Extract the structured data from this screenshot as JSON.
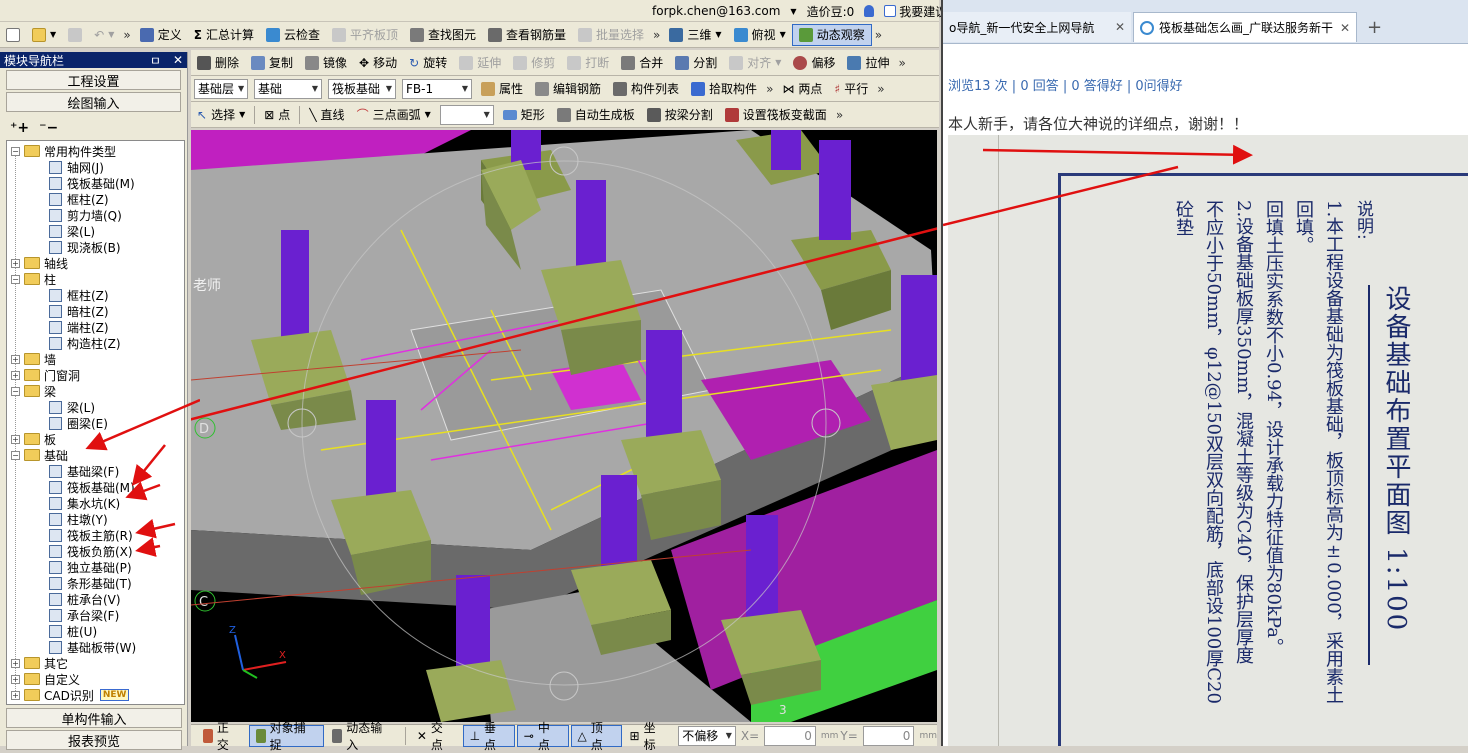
{
  "account": {
    "email": "forpk.chen@163.com",
    "credit": "造价豆:0",
    "suggest": "我要建议"
  },
  "toolbar1": {
    "define": "定义",
    "sum_calc": "汇总计算",
    "cloud_check": "云检查",
    "level_slab": "平齐板顶",
    "find_element": "查找图元",
    "view_rebar": "查看钢筋量",
    "batch_select": "批量选择",
    "view3d": "三维",
    "top_view": "俯视",
    "dynamic_view": "动态观察"
  },
  "toolbar2": {
    "delete": "删除",
    "copy": "复制",
    "mirror": "镜像",
    "move": "移动",
    "rotate": "旋转",
    "extend": "延伸",
    "trim": "修剪",
    "break": "打断",
    "merge": "合并",
    "split": "分割",
    "align": "对齐",
    "offset": "偏移",
    "stretch": "拉伸"
  },
  "toolbar3": {
    "layer": "基础层",
    "category": "基础",
    "type": "筏板基础",
    "element": "FB-1",
    "properties": "属性",
    "edit_rebar": "编辑钢筋",
    "component_list": "构件列表",
    "pick": "拾取构件",
    "two_points": "两点",
    "parallel": "平行"
  },
  "toolbar4": {
    "select": "选择",
    "point": "点",
    "line": "直线",
    "arc3": "三点画弧",
    "rect": "矩形",
    "auto_gen": "自动生成板",
    "by_beam": "按梁分割",
    "section": "设置筏板变截面"
  },
  "nav": {
    "title": "模块导航栏",
    "pin": "ㅁ",
    "close": "✕",
    "project_settings": "工程设置",
    "draw_input": "绘图输入",
    "single_input": "单构件输入",
    "report": "报表预览",
    "tree": [
      {
        "label": "常用构件类型",
        "level": 0,
        "exp": "−",
        "folder": true
      },
      {
        "label": "轴网(J)",
        "level": 1
      },
      {
        "label": "筏板基础(M)",
        "level": 1
      },
      {
        "label": "框柱(Z)",
        "level": 1
      },
      {
        "label": "剪力墙(Q)",
        "level": 1
      },
      {
        "label": "梁(L)",
        "level": 1
      },
      {
        "label": "现浇板(B)",
        "level": 1
      },
      {
        "label": "轴线",
        "level": 0,
        "exp": "+",
        "folder": true
      },
      {
        "label": "柱",
        "level": 0,
        "exp": "−",
        "folder": true
      },
      {
        "label": "框柱(Z)",
        "level": 1
      },
      {
        "label": "暗柱(Z)",
        "level": 1
      },
      {
        "label": "端柱(Z)",
        "level": 1
      },
      {
        "label": "构造柱(Z)",
        "level": 1
      },
      {
        "label": "墙",
        "level": 0,
        "exp": "+",
        "folder": true
      },
      {
        "label": "门窗洞",
        "level": 0,
        "exp": "+",
        "folder": true
      },
      {
        "label": "梁",
        "level": 0,
        "exp": "−",
        "folder": true
      },
      {
        "label": "梁(L)",
        "level": 1
      },
      {
        "label": "圈梁(E)",
        "level": 1
      },
      {
        "label": "板",
        "level": 0,
        "exp": "+",
        "folder": true
      },
      {
        "label": "基础",
        "level": 0,
        "exp": "−",
        "folder": true
      },
      {
        "label": "基础梁(F)",
        "level": 1
      },
      {
        "label": "筏板基础(M)",
        "level": 1
      },
      {
        "label": "集水坑(K)",
        "level": 1
      },
      {
        "label": "柱墩(Y)",
        "level": 1
      },
      {
        "label": "筏板主筋(R)",
        "level": 1
      },
      {
        "label": "筏板负筋(X)",
        "level": 1
      },
      {
        "label": "独立基础(P)",
        "level": 1
      },
      {
        "label": "条形基础(T)",
        "level": 1
      },
      {
        "label": "桩承台(V)",
        "level": 1
      },
      {
        "label": "承台梁(F)",
        "level": 1
      },
      {
        "label": "桩(U)",
        "level": 1
      },
      {
        "label": "基础板带(W)",
        "level": 1
      },
      {
        "label": "其它",
        "level": 0,
        "exp": "+",
        "folder": true
      },
      {
        "label": "自定义",
        "level": 0,
        "exp": "+",
        "folder": true
      },
      {
        "label": "CAD识别",
        "level": 0,
        "exp": "+",
        "folder": true,
        "badge": "NEW"
      }
    ]
  },
  "view": {
    "teacher": "老师",
    "axis_d": "D",
    "axis_c": "C",
    "axis_3": "3"
  },
  "status": {
    "ortho": "正交",
    "snap": "对象捕捉",
    "dyn_input": "动态输入",
    "intersect": "交点",
    "perp": "垂点",
    "mid": "中点",
    "vertex": "顶点",
    "coord": "坐标",
    "no_offset": "不偏移",
    "x_label": "X=",
    "x_val": "0",
    "y_label": "Y=",
    "y_val": "0",
    "unit": "mm"
  },
  "browser": {
    "tab1": "o导航_新一代安全上网导航",
    "tab2": "筏板基础怎么画_广联达服务新干",
    "new_tab": "+",
    "stats": "浏览13 次 | 0 回答 | 0 答得好 | 0问得好",
    "question": "本人新手，请各位大神说的详细点，谢谢！！",
    "photo": {
      "title": "设备基础布置平面图 1:100",
      "note_head": "说明:",
      "note_lines": [
        "1.本工程设备基础为筏板基础，板顶标高为±0.000，采用素土回填。",
        "回填土压实系数不小0.94，设计承载力特征值为80kPa。",
        "2.设备基础板厚350mm，混凝土等级为C40，保护层厚度",
        "不应小于50mm，φ12@150双层双向配筋，底部设100厚C20砼垫"
      ]
    }
  }
}
